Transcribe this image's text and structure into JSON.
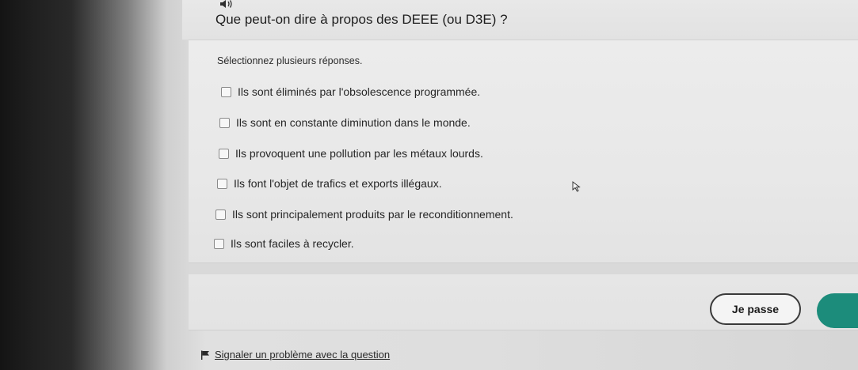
{
  "question": {
    "title": "Que peut-on dire à propos des DEEE (ou D3E) ?",
    "audio_icon": "speaker-icon"
  },
  "instruction": "Sélectionnez plusieurs réponses.",
  "options": [
    {
      "label": "Ils sont éliminés par l'obsolescence programmée.",
      "checked": false
    },
    {
      "label": "Ils sont en constante diminution dans le monde.",
      "checked": false
    },
    {
      "label": "Ils provoquent une pollution par les métaux lourds.",
      "checked": false
    },
    {
      "label": "Ils font l'objet de trafics et exports illégaux.",
      "checked": false
    },
    {
      "label": "Ils sont principalement produits par le reconditionnement.",
      "checked": false
    },
    {
      "label": "Ils sont faciles à recycler.",
      "checked": false
    }
  ],
  "footer": {
    "skip_label": "Je passe",
    "validate_color": "#1c8c7b"
  },
  "report": {
    "label": "Signaler un problème avec la question",
    "icon": "flag-icon"
  }
}
